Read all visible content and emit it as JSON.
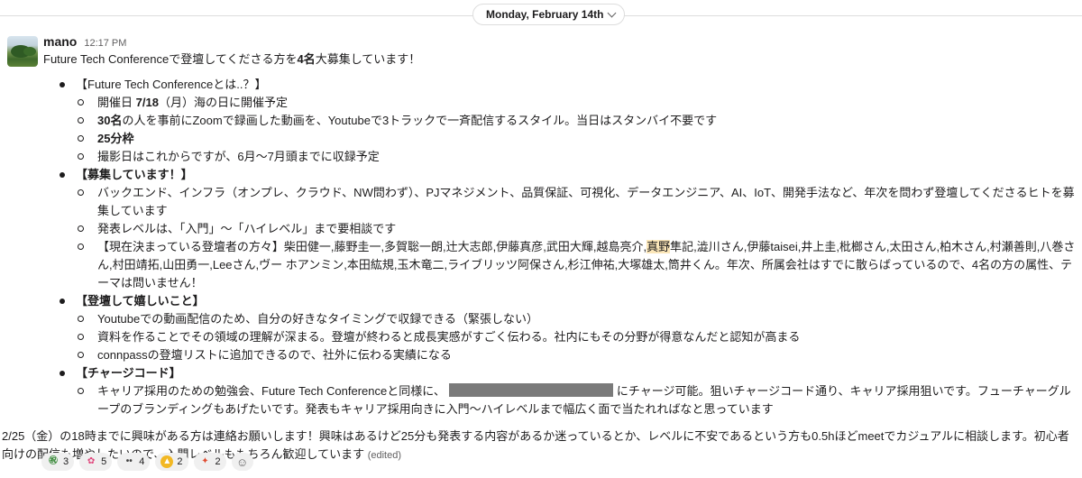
{
  "date_divider": "Monday, February 14th",
  "message": {
    "author": "mano",
    "time": "12:17 PM",
    "intro_pre": "Future Tech Conferenceで登壇してくださる方を",
    "intro_bold": "4名",
    "intro_post": "大募集しています！",
    "s1": {
      "heading": "【Future Tech Conferenceとは..？】",
      "i1_pre": "開催日 ",
      "i1_bold": "7/18",
      "i1_post": "（月）海の日に開催予定",
      "i2_bold": "30名",
      "i2_post": "の人を事前にZoomで録画した動画を、Youtubeで3トラックで一斉配信するスタイル。当日はスタンバイ不要です",
      "i3_bold": "25分枠",
      "i4": "撮影日はこれからですが、6月〜7月頭までに収録予定"
    },
    "s2": {
      "heading": "【募集しています！】",
      "i1": "バックエンド、インフラ（オンプレ、クラウド、NW問わず）、PJマネジメント、品質保証、可視化、データエンジニア、AI、IoT、開発手法など、年次を問わず登壇してくださるヒトを募集しています",
      "i2": "発表レベルは、「入門」〜「ハイレベル」まで要相談です",
      "i3_pre": "【現在決まっている登壇者の方々】柴田健一,藤野圭一,多賀聡一朗,辻大志郎,伊藤真彦,武田大輝,越島亮介,",
      "i3_hl": "真野",
      "i3_post": "隼記,澁川さん,伊藤taisei,井上圭,枇榔さん,太田さん,柏木さん,村瀬善則,八巻さん,村田靖拓,山田勇一,Leeさん,ヴー ホアンミン,本田紘規,玉木竜二,ライブリッツ阿保さん,杉江伸祐,大塚雄太,筒井くん。年次、所属会社はすでに散らばっているので、4名の方の属性、テーマは問いません！"
    },
    "s3": {
      "heading": "【登壇して嬉しいこと】",
      "i1": "Youtubeでの動画配信のため、自分の好きなタイミングで収録できる（緊張しない）",
      "i2": "資料を作ることでその領域の理解が深まる。登壇が終わると成長実感がすごく伝わる。社内にもその分野が得意なんだと認知が高まる",
      "i3": "connpassの登壇リストに追加できるので、社外に伝わる実績になる"
    },
    "s4": {
      "heading": "【チャージコード】",
      "i1_pre": "キャリア採用のための勉強会、Future Tech Conferenceと同様に、",
      "i1_post": "にチャージ可能。狙いチャージコード通り、キャリア採用狙いです。フューチャーグループのブランディングもあげたいです。発表もキャリア採用向きに入門〜ハイレベルまで幅広く面で当たれればなと思っています"
    },
    "footer": "2/25（金）の18時までに興味がある方は連絡お願いします！興味はあるけど25分も発表する内容があるか迷っているとか、レベルに不安であるという方も0.5hほどmeetでカジュアルに相談します。初心者向けの配信も増やしたいので、入門レベルももちろん歓迎しています",
    "edited": "(edited)"
  },
  "reactions": [
    {
      "icon": "kanji-emoji-icon",
      "count": "3",
      "color": "#3a8a3a"
    },
    {
      "icon": "pink-kanji-emoji-icon",
      "count": "5",
      "color": "#e0457b"
    },
    {
      "icon": "eyes-icon",
      "count": "4",
      "color": "#444444"
    },
    {
      "icon": "thumbs-up-icon",
      "count": "2",
      "color": "#f2b824"
    },
    {
      "icon": "red-kanji-emoji-icon",
      "count": "2",
      "color": "#e04a2f"
    }
  ]
}
